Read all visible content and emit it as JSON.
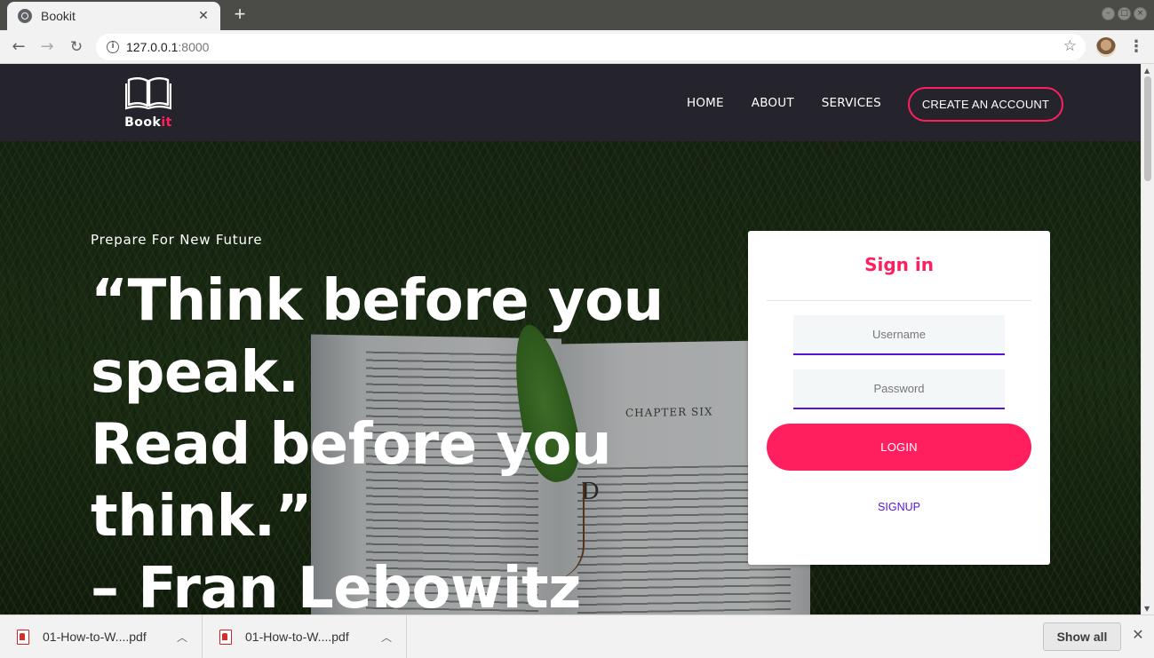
{
  "browser": {
    "tab_title": "Bookit",
    "new_tab_glyph": "+",
    "url_host": "127.0.0.1",
    "url_port": ":8000"
  },
  "site": {
    "logo_main": "Book",
    "logo_accent": "it",
    "nav": [
      "HOME",
      "ABOUT",
      "SERVICES"
    ],
    "cta": "CREATE AN ACCOUNT"
  },
  "hero": {
    "tagline": "Prepare For New Future",
    "quote_lines": [
      "“Think before you",
      "speak.",
      "Read before you",
      "think.”",
      "– Fran Lebowitz"
    ],
    "book_chapter": "CHAPTER SIX",
    "book_drop_cap": "D"
  },
  "signin": {
    "title": "Sign in",
    "username_placeholder": "Username",
    "password_placeholder": "Password",
    "login_label": "LOGIN",
    "signup_label": "SIGNUP"
  },
  "downloads": {
    "items": [
      {
        "name": "01-How-to-W....pdf"
      },
      {
        "name": "01-How-to-W....pdf"
      }
    ],
    "show_all": "Show all"
  },
  "colors": {
    "accent": "#ff1f5e",
    "link": "#5713d9",
    "header_bg": "#25242c"
  }
}
